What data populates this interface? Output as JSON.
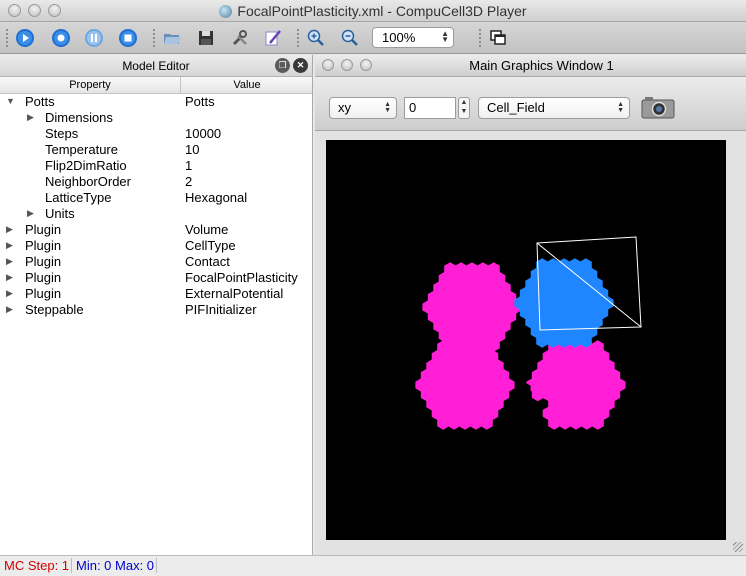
{
  "window": {
    "title": "FocalPointPlasticity.xml - CompuCell3D Player"
  },
  "toolbar": {
    "buttons": [
      "run",
      "step",
      "pause",
      "stop",
      "open",
      "save",
      "configure",
      "edit",
      "zoom-in",
      "zoom-out"
    ],
    "zoom_value": "100%"
  },
  "model_editor": {
    "title": "Model Editor",
    "col_property": "Property",
    "col_value": "Value",
    "rows": [
      {
        "name": "Potts",
        "value": "Potts",
        "expander": "open"
      },
      {
        "name": "Dimensions",
        "value": "",
        "expander": "closed"
      },
      {
        "name": "Steps",
        "value": "10000",
        "expander": ""
      },
      {
        "name": "Temperature",
        "value": "10",
        "expander": ""
      },
      {
        "name": "Flip2DimRatio",
        "value": "1",
        "expander": ""
      },
      {
        "name": "NeighborOrder",
        "value": "2",
        "expander": ""
      },
      {
        "name": "LatticeType",
        "value": "Hexagonal",
        "expander": ""
      },
      {
        "name": "Units",
        "value": "",
        "expander": "closed"
      },
      {
        "name": "Plugin",
        "value": "Volume",
        "expander": "closed"
      },
      {
        "name": "Plugin",
        "value": "CellType",
        "expander": "closed"
      },
      {
        "name": "Plugin",
        "value": "Contact",
        "expander": "closed"
      },
      {
        "name": "Plugin",
        "value": "FocalPointPlasticity",
        "expander": "closed"
      },
      {
        "name": "Plugin",
        "value": "ExternalPotential",
        "expander": "closed"
      },
      {
        "name": "Steppable",
        "value": "PIFInitializer",
        "expander": "closed"
      }
    ]
  },
  "graphics_window": {
    "title": "Main Graphics Window 1",
    "plane": "xy",
    "slice": "0",
    "field": "Cell_Field",
    "colors": {
      "magenta": "#ff1fd6",
      "blue": "#1f86ff",
      "background": "#000000"
    }
  },
  "status": {
    "mc_step_label": "MC Step: 1",
    "min_max_label": "Min: 0 Max: 0",
    "mc_color": "#d40000",
    "minmax_color": "#0000cc"
  }
}
